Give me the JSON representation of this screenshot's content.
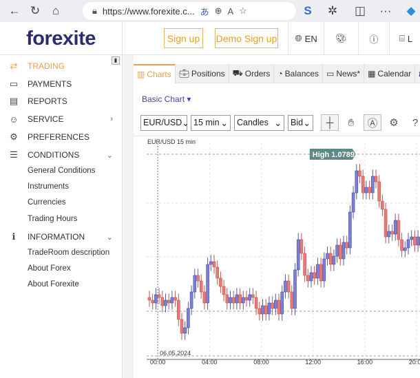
{
  "browser": {
    "url": "https://www.forexite.c...",
    "icons": [
      "back-icon",
      "reload-icon",
      "home-icon",
      "lock-icon",
      "translate-icon",
      "zoom-icon",
      "read-aloud-icon",
      "favorite-icon",
      "extension-s-icon",
      "extensions-icon",
      "split-screen-icon",
      "more-icon",
      "copilot-icon"
    ]
  },
  "header": {
    "logo": "forexite",
    "signup": "Sign up",
    "demo_signup": "Demo Sign up",
    "language": "EN",
    "login_partial": "L"
  },
  "sidebar": {
    "items": [
      {
        "label": "TRADING",
        "icon": "transfer-icon",
        "active": true
      },
      {
        "label": "PAYMENTS",
        "icon": "wallet-icon"
      },
      {
        "label": "REPORTS",
        "icon": "document-icon"
      },
      {
        "label": "SERVICE",
        "icon": "service-icon",
        "chevron": "right"
      },
      {
        "label": "PREFERENCES",
        "icon": "gear-icon"
      },
      {
        "label": "CONDITIONS",
        "icon": "list-icon",
        "chevron": "down"
      },
      {
        "label": "INFORMATION",
        "icon": "info-icon",
        "chevron": "down"
      }
    ],
    "conditions_sub": [
      "General Conditions",
      "Instruments",
      "Currencies",
      "Trading Hours"
    ],
    "information_sub": [
      "TradeRoom description",
      "About Forex",
      "About Forexite"
    ]
  },
  "tabs": [
    {
      "label": "Charts",
      "icon": "chart-icon",
      "active": true
    },
    {
      "label": "Positions",
      "icon": "briefcase-icon"
    },
    {
      "label": "Orders",
      "icon": "orders-icon"
    },
    {
      "label": "Balances",
      "icon": "pie-icon"
    },
    {
      "label": "News*",
      "icon": "news-icon"
    },
    {
      "label": "Calendar",
      "icon": "calendar-icon"
    },
    {
      "label": "f",
      "icon": "fx-icon"
    }
  ],
  "chart_toolbar": {
    "basic_chart": "Basic Chart ▾",
    "symbol": "EUR/USD",
    "interval": "15 min",
    "type": "Candles",
    "price": "Bid"
  },
  "chart_data": {
    "type": "candlestick",
    "title": "EUR/USD 15 min",
    "date_label": "06.05.2024",
    "x_ticks": [
      "00:00",
      "04:00",
      "08:00",
      "12:00",
      "16:00",
      "20:00"
    ],
    "high_label": "High 1.0789",
    "high": 1.0789,
    "up_color": "#7b7fd8",
    "down_color": "#e57a76",
    "start_time": "23:15",
    "interval_minutes": 15,
    "closes": [
      1.07625,
      1.0762,
      1.07635,
      1.0763,
      1.07615,
      1.07625,
      1.0762,
      1.0763,
      1.07625,
      1.0759,
      1.07565,
      1.07575,
      1.0761,
      1.0764,
      1.0767,
      1.0766,
      1.0764,
      1.0762,
      1.0769,
      1.07695,
      1.07685,
      1.07665,
      1.0765,
      1.07635,
      1.0762,
      1.0763,
      1.0762,
      1.07635,
      1.0762,
      1.0763,
      1.07625,
      1.07635,
      1.0763,
      1.0761,
      1.076,
      1.07615,
      1.076,
      1.0762,
      1.0761,
      1.07625,
      1.076,
      1.0764,
      1.0766,
      1.0764,
      1.0761,
      1.0768,
      1.07735,
      1.0771,
      1.0767,
      1.0766,
      1.07675,
      1.07665,
      1.0769,
      1.0766,
      1.077,
      1.0771,
      1.0769,
      1.07705,
      1.07725,
      1.077,
      1.0773,
      1.0772,
      1.07785,
      1.0782,
      1.0786,
      1.0785,
      1.0782,
      1.0783,
      1.0782,
      1.0785,
      1.0784,
      1.07805,
      1.0779,
      1.0774,
      1.0775,
      1.07745,
      1.0777,
      1.07735,
      1.07715,
      1.0772,
      1.07735,
      1.0774,
      1.07725,
      1.0774,
      1.0772
    ]
  }
}
